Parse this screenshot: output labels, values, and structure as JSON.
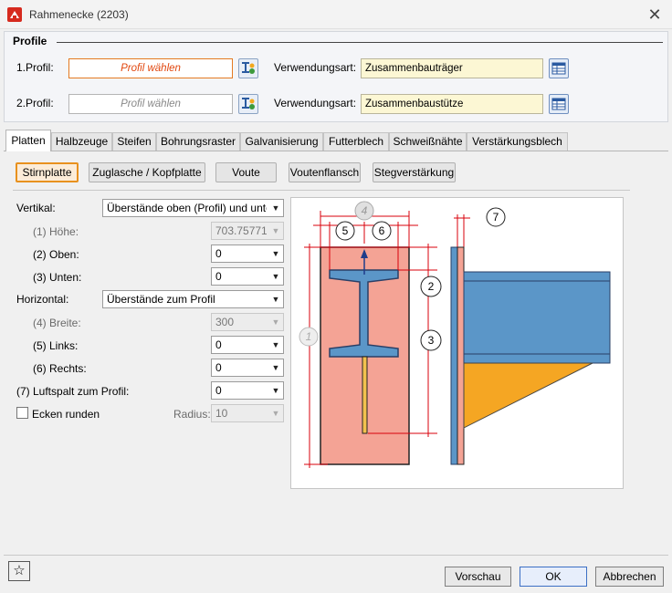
{
  "window": {
    "title": "Rahmenecke (2203)"
  },
  "profile_group": {
    "title": "Profile",
    "profile1": {
      "label": "1.Profil:",
      "value": "Profil wählen",
      "use_label": "Verwendungsart:",
      "use_value": "Zusammenbauträger"
    },
    "profile2": {
      "label": "2.Profil:",
      "value": "Profil wählen",
      "use_label": "Verwendungsart:",
      "use_value": "Zusammenbaustütze"
    }
  },
  "tabs": [
    "Platten",
    "Halbzeuge",
    "Steifen",
    "Bohrungsraster",
    "Galvanisierung",
    "Futterblech",
    "Schweißnähte",
    "Verstärkungsblech"
  ],
  "subtabs": [
    "Stirnplatte",
    "Zuglasche / Kopfplatte",
    "Voute",
    "Voutenflansch",
    "Stegverstärkung"
  ],
  "form": {
    "vertical_label": "Vertikal:",
    "vertical_value": "Überstände oben (Profil) und unten",
    "height_label": "(1) Höhe:",
    "height_value": "703.757710",
    "top_label": "(2) Oben:",
    "top_value": "0",
    "bottom_label": "(3) Unten:",
    "bottom_value": "0",
    "horizontal_label": "Horizontal:",
    "horizontal_value": "Überstände zum Profil",
    "width_label": "(4) Breite:",
    "width_value": "300",
    "left_label": "(5) Links:",
    "left_value": "0",
    "right_label": "(6) Rechts:",
    "right_value": "0",
    "gap_label": "(7) Luftspalt zum Profil:",
    "gap_value": "0",
    "round_label": "Ecken runden",
    "round_checked": false,
    "radius_label": "Radius:",
    "radius_value": "10"
  },
  "diagram": {
    "callouts": [
      "1",
      "2",
      "3",
      "4",
      "5",
      "6",
      "7"
    ],
    "colors": {
      "plate": "#f4a395",
      "profile": "#5b96c8",
      "haunch": "#f5a623",
      "dimension": "#d9000b"
    }
  },
  "footer": {
    "preview_label": "Vorschau",
    "ok_label": "OK",
    "cancel_label": "Abbrechen"
  },
  "icons": {
    "favorite": "star-icon",
    "close": "close-icon",
    "pick": "profile-pick-icon",
    "table": "table-icon",
    "app": "app-icon"
  }
}
